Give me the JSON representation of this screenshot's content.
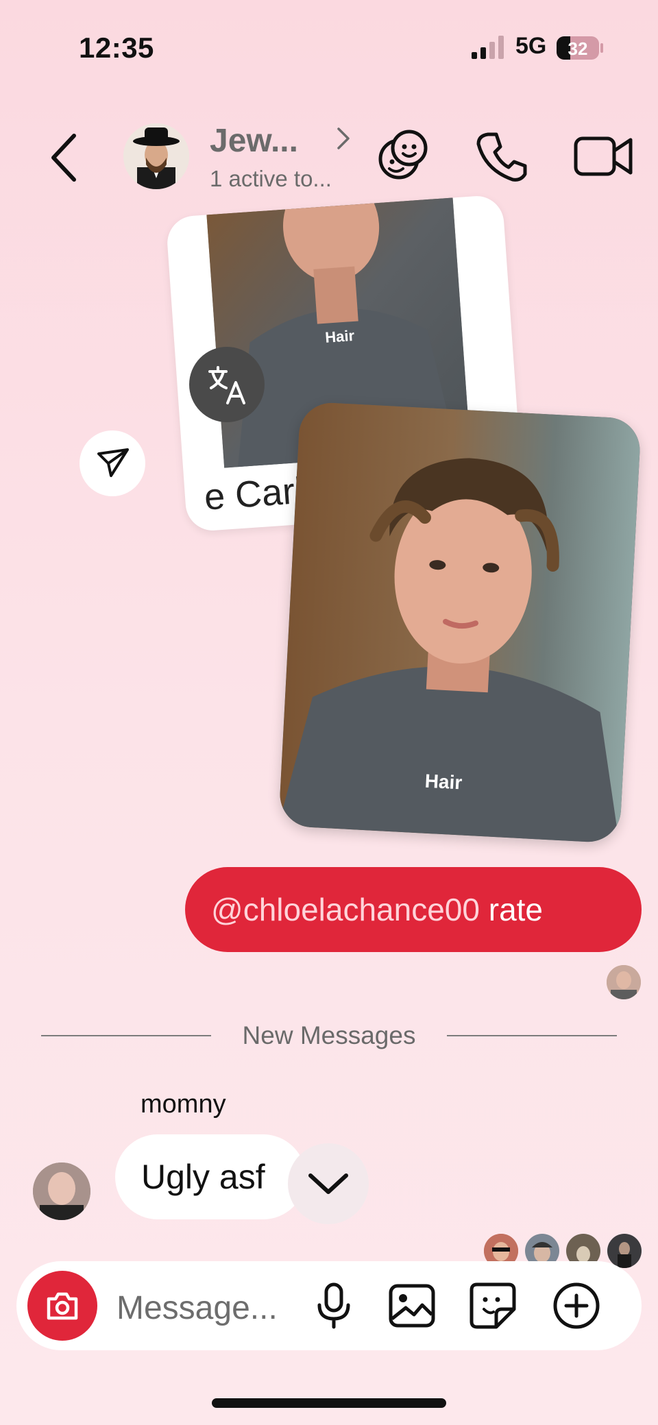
{
  "status_bar": {
    "time": "12:35",
    "network": "5G",
    "battery_level": 32,
    "battery_label": "32"
  },
  "header": {
    "title": "Jew...",
    "subtitle": "1 active to..."
  },
  "media": {
    "card_caption": "e Carb",
    "shirt_text": "Hair"
  },
  "messages": {
    "outgoing": {
      "mention": "@chloelachance00",
      "text": " rate"
    },
    "divider": "New Messages",
    "incoming": {
      "sender": "momny",
      "text": "Ugly asf"
    }
  },
  "composer": {
    "placeholder": "Message..."
  },
  "colors": {
    "accent": "#e0263a",
    "background": "#fbd9e0"
  }
}
